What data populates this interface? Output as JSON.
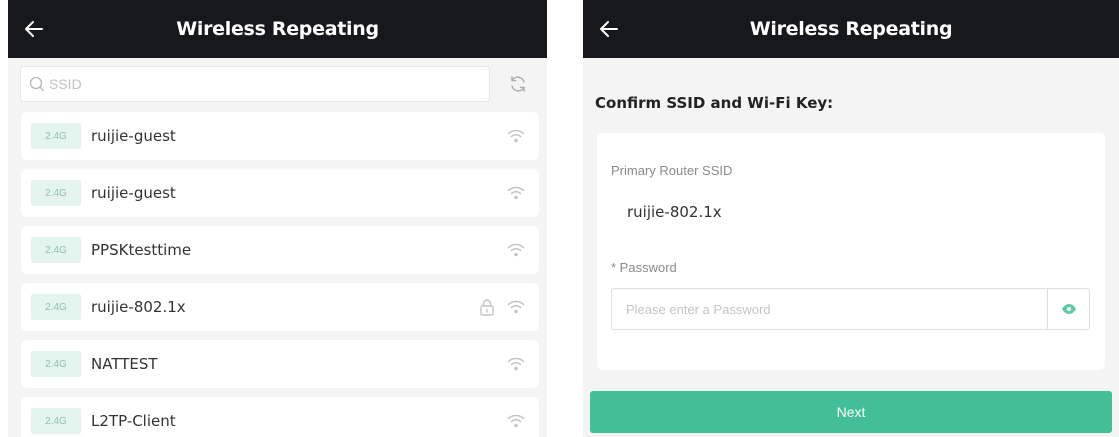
{
  "left": {
    "header": {
      "title": "Wireless Repeating",
      "back_icon": "arrow-left-icon"
    },
    "search": {
      "placeholder": "SSID",
      "value": ""
    },
    "networks": [
      {
        "band": "2.4G",
        "ssid": "ruijie-guest",
        "locked": false
      },
      {
        "band": "2.4G",
        "ssid": "ruijie-guest",
        "locked": false
      },
      {
        "band": "2.4G",
        "ssid": "PPSKtesttime",
        "locked": false
      },
      {
        "band": "2.4G",
        "ssid": "ruijie-802.1x",
        "locked": true
      },
      {
        "band": "2.4G",
        "ssid": "NATTEST",
        "locked": false
      },
      {
        "band": "2.4G",
        "ssid": "L2TP-Client",
        "locked": false
      }
    ]
  },
  "right": {
    "header": {
      "title": "Wireless Repeating",
      "back_icon": "arrow-left-icon"
    },
    "confirm_heading": "Confirm SSID and Wi-Fi Key:",
    "ssid_label": "Primary Router SSID",
    "ssid_value": "ruijie-802.1x",
    "password_label": "* Password",
    "password_placeholder": "Please enter a Password",
    "password_value": "",
    "next_label": "Next"
  },
  "colors": {
    "header_bg": "#16181d",
    "accent": "#43bf97",
    "band_bg": "#e3f5ee",
    "page_bg": "#f4f4f4"
  }
}
